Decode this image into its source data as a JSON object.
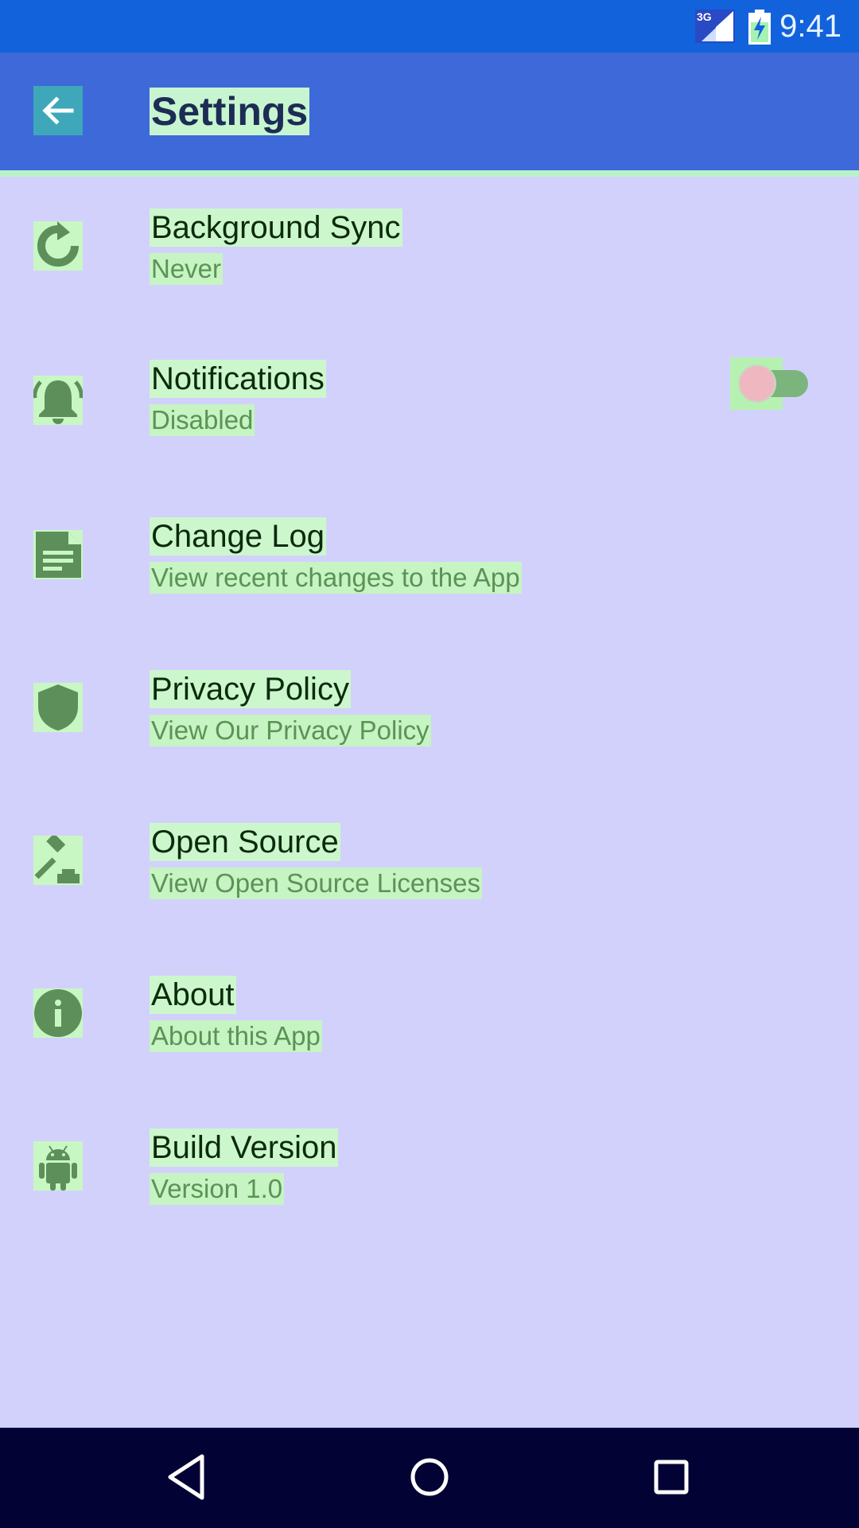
{
  "status_bar": {
    "network_label": "3G",
    "time": "9:41",
    "icons": [
      "signal-icon",
      "battery-icon"
    ]
  },
  "app_bar": {
    "title": "Settings",
    "back_icon": "arrow-back-icon"
  },
  "settings": [
    {
      "title": "Background Sync",
      "subtitle": "Never",
      "icon": "sync-icon"
    },
    {
      "title": "Notifications",
      "subtitle": "Disabled",
      "icon": "bell-icon",
      "toggle_on": false
    },
    {
      "title": "Change Log",
      "subtitle": "View recent changes to the App",
      "icon": "document-icon"
    },
    {
      "title": "Privacy Policy",
      "subtitle": "View Our Privacy Policy",
      "icon": "shield-icon"
    },
    {
      "title": "Open Source",
      "subtitle": "View Open Source Licenses",
      "icon": "gavel-icon"
    },
    {
      "title": "About",
      "subtitle": "About this App",
      "icon": "info-icon"
    },
    {
      "title": "Build Version",
      "subtitle": "Version 1.0",
      "icon": "android-icon"
    }
  ],
  "nav_bar": {
    "icons": [
      "back-triangle-icon",
      "home-circle-icon",
      "recents-square-icon"
    ]
  },
  "colors": {
    "status_bar": "#1262dc",
    "app_bar": "#3e69d9",
    "background": "#d2d1fb",
    "icon_green": "#5c8f5a",
    "nav_bar": "#020234"
  }
}
